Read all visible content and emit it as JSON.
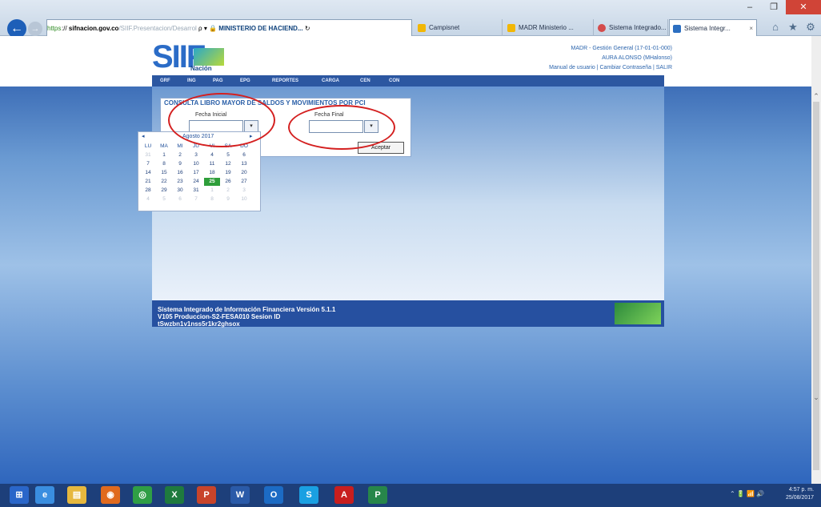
{
  "browser": {
    "address": {
      "protocol": "https",
      "host": "sifnacion.gov.co",
      "path": "/SIIF.Presentacion/Desarrol",
      "search_glyph": "ρ ▾",
      "lock_glyph": "🔒",
      "site_name": "MINISTERIO DE HACIEND...",
      "refresh_glyph": "↻"
    },
    "tabs": [
      {
        "label": "Campisnet",
        "icon_color": "#f2b705"
      },
      {
        "label": "MADR Ministerio ...",
        "icon_color": "#f2b705"
      },
      {
        "label": "Sistema Integrado...",
        "icon_color": "#d44b4b"
      },
      {
        "label": "Sistema Integr...",
        "icon_color": "#2c6fc1",
        "close": "×"
      }
    ],
    "window_buttons": {
      "minimize": "–",
      "maximize": "❐",
      "close": "✕"
    },
    "toolbar_icons": [
      "home-icon",
      "star-icon",
      "gear-icon"
    ],
    "toolbar_glyphs": {
      "home": "⌂",
      "star": "★",
      "gear": "⚙"
    }
  },
  "app": {
    "logo_text": "SIIF",
    "logo_sub": "Nación",
    "user_lines": [
      "MADR - Gestión General (17-01-01-000)",
      "AURA ALONSO (MHalonso)",
      "Manual de usuario | Cambiar Contraseña | SALIR"
    ],
    "nav": [
      "GRF",
      "ING",
      "PAG",
      "EPG",
      "REPORTES",
      "CARGA",
      "CEN",
      "CON"
    ],
    "form": {
      "title": "CONSULTA LIBRO MAYOR DE SALDOS Y MOVIMIENTOS POR PCI",
      "fecha_inicial_label": "Fecha Inicial",
      "fecha_final_label": "Fecha Final",
      "fecha_inicial_value": "",
      "fecha_final_value": "",
      "dropdown_glyph": "▾",
      "aceptar_label": "Aceptar"
    },
    "calendar": {
      "prev": "◂",
      "next": "▸",
      "month": "Agosto 2017",
      "days": [
        "LU",
        "MA",
        "MI",
        "JU",
        "VI",
        "SA",
        "DO"
      ],
      "weeks": [
        [
          "31",
          "1",
          "2",
          "3",
          "4",
          "5",
          "6"
        ],
        [
          "7",
          "8",
          "9",
          "10",
          "11",
          "12",
          "13"
        ],
        [
          "14",
          "15",
          "16",
          "17",
          "18",
          "19",
          "20"
        ],
        [
          "21",
          "22",
          "23",
          "24",
          "25",
          "26",
          "27"
        ],
        [
          "28",
          "29",
          "30",
          "31",
          "1",
          "2",
          "3"
        ],
        [
          "4",
          "5",
          "6",
          "7",
          "8",
          "9",
          "10"
        ]
      ],
      "selected": "25"
    },
    "footer_lines": [
      "Sistema Integrado de Información Financiera Versión 5.1.1",
      "V105 Produccion-S2-FESA010 Sesion ID",
      "tSwzbn1v1nss5r1kr2ghsox"
    ]
  },
  "taskbar": {
    "apps": [
      {
        "name": "windows-start-icon",
        "glyph": "⊞",
        "color": "#2a66c9"
      },
      {
        "name": "ie-icon",
        "glyph": "e",
        "color": "#3a8ee0"
      },
      {
        "name": "file-explorer-icon",
        "glyph": "▤",
        "color": "#e6b83e"
      },
      {
        "name": "firefox-icon",
        "glyph": "◉",
        "color": "#e06a1e"
      },
      {
        "name": "chrome-icon",
        "glyph": "◎",
        "color": "#2f9e45"
      },
      {
        "name": "excel-icon",
        "glyph": "X",
        "color": "#1f7a3e"
      },
      {
        "name": "powerpoint-icon",
        "glyph": "P",
        "color": "#c8442a"
      },
      {
        "name": "word-icon",
        "glyph": "W",
        "color": "#2a5aa8"
      },
      {
        "name": "outlook-icon",
        "glyph": "O",
        "color": "#1c6bc4"
      },
      {
        "name": "skype-icon",
        "glyph": "S",
        "color": "#1aa0e2"
      },
      {
        "name": "acrobat-icon",
        "glyph": "A",
        "color": "#c81e1e"
      },
      {
        "name": "project-icon",
        "glyph": "P",
        "color": "#27864a"
      }
    ],
    "time": "4:57 p. m.",
    "date": "25/08/2017",
    "tray_glyphs": "⌃ 🔋 📶 🔊"
  }
}
